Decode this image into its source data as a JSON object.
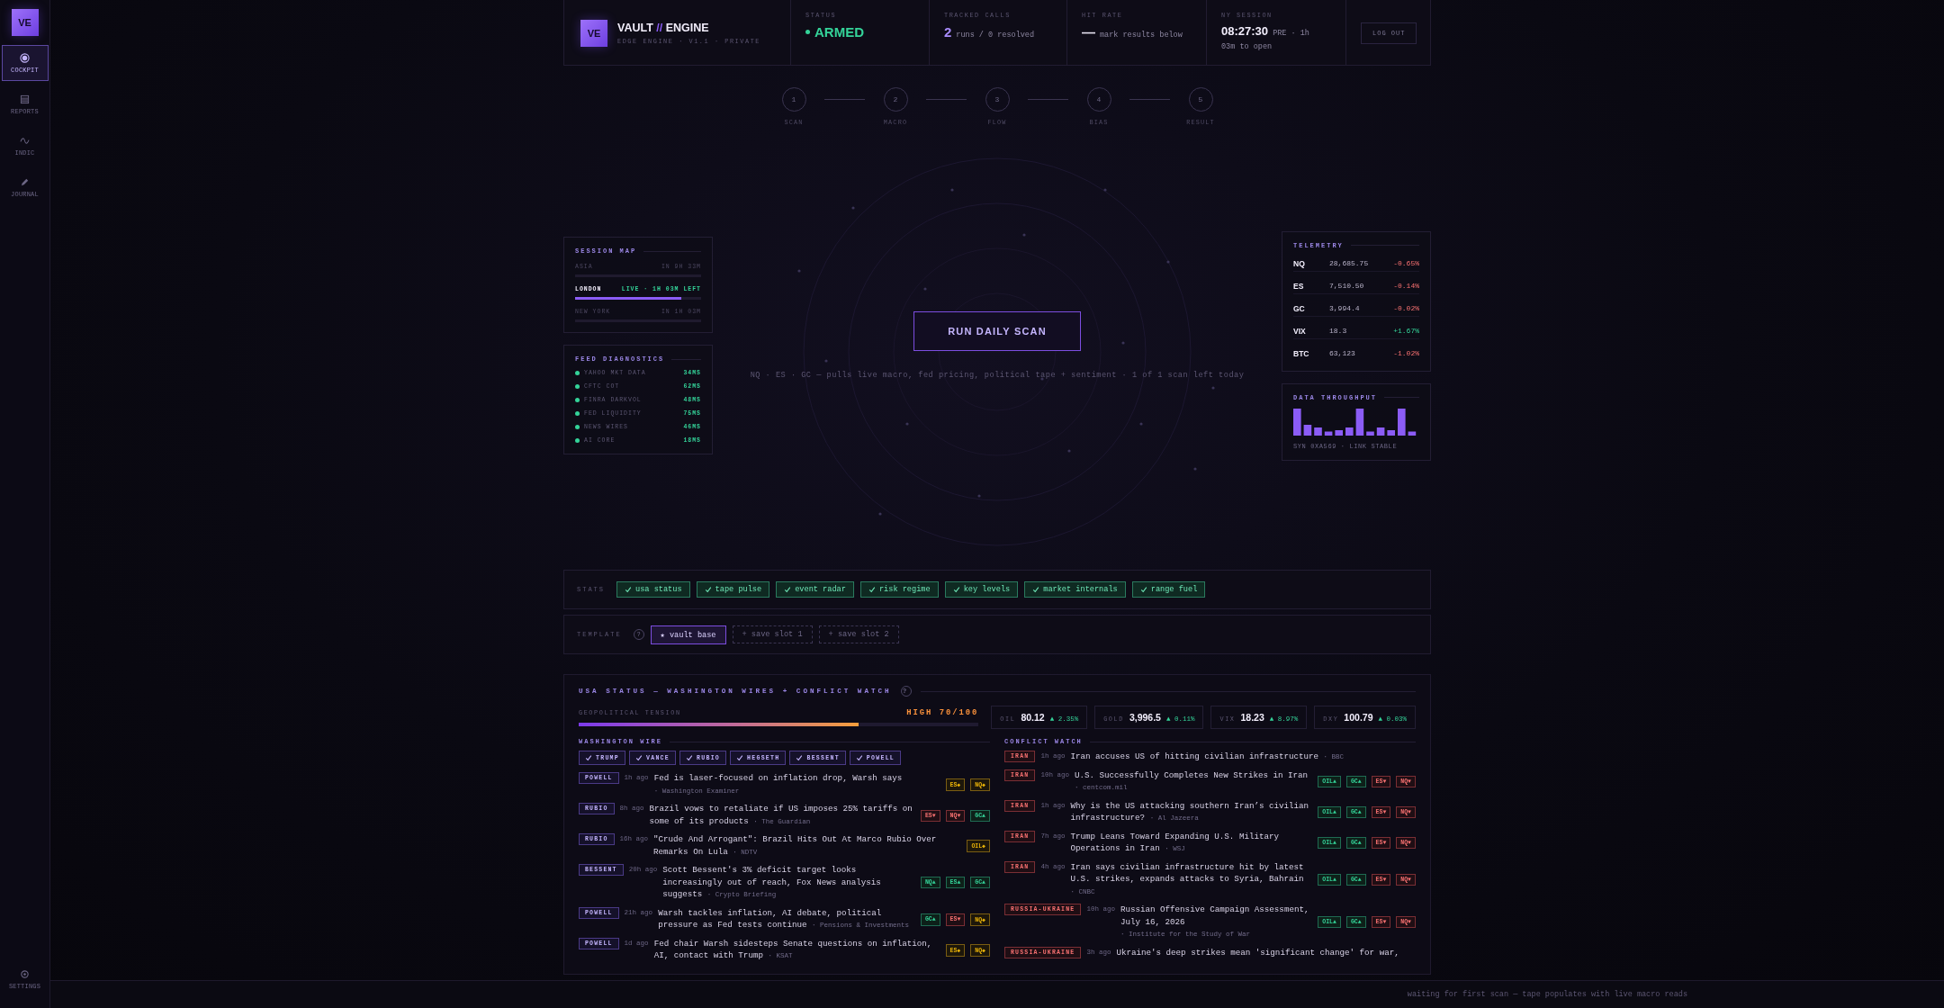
{
  "sidebar": {
    "logo": "VE",
    "items": [
      {
        "label": "COCKPIT",
        "selected": true
      },
      {
        "label": "REPORTS",
        "selected": false
      },
      {
        "label": "INDIC",
        "selected": false
      },
      {
        "label": "JOURNAL",
        "selected": false
      }
    ],
    "settings": "SETTINGS"
  },
  "header": {
    "logo": "VE",
    "title_left": "VAULT",
    "title_separator": "//",
    "title_right": "ENGINE",
    "subtitle": "EDGE ENGINE · V1.1 · PRIVATE",
    "status": {
      "label": "STATUS",
      "value": "ARMED",
      "armed": true
    },
    "tracked": {
      "label": "TRACKED CALLS",
      "count": "2",
      "detail": "runs / 0 resolved"
    },
    "hit_rate": {
      "label": "HIT RATE",
      "value": "—",
      "detail": "mark results below"
    },
    "session": {
      "label": "NY SESSION",
      "time": "08:27:30",
      "detail": "PRE · 1h 03m to open"
    },
    "logout": "LOG OUT"
  },
  "steps": [
    {
      "number": "1",
      "label": "SCAN"
    },
    {
      "number": "2",
      "label": "MACRO"
    },
    {
      "number": "3",
      "label": "FLOW"
    },
    {
      "number": "4",
      "label": "BIAS"
    },
    {
      "number": "5",
      "label": "RESULT"
    }
  ],
  "session_map": {
    "title": "SESSION MAP",
    "rows": [
      {
        "name": "ASIA",
        "status": "IN 9H 33M",
        "live": false
      },
      {
        "name": "LONDON",
        "status": "LIVE · 1H 03M LEFT",
        "live": true,
        "level": 0.84
      },
      {
        "name": "NEW YORK",
        "status": "IN 1H 03M",
        "live": false
      }
    ]
  },
  "feed_diagnostics": {
    "title": "FEED DIAGNOSTICS",
    "feeds": [
      {
        "name": "YAHOO MKT DATA",
        "latency": "34MS"
      },
      {
        "name": "CFTC COT",
        "latency": "62MS"
      },
      {
        "name": "FINRA DARKVOL",
        "latency": "48MS"
      },
      {
        "name": "FED LIQUIDITY",
        "latency": "75MS"
      },
      {
        "name": "NEWS WIRES",
        "latency": "46MS"
      },
      {
        "name": "AI CORE",
        "latency": "18MS"
      }
    ]
  },
  "scan": {
    "button": "RUN DAILY SCAN",
    "note": "NQ · ES · GC — pulls live macro, fed pricing, political tape + sentiment · 1 of 1 scan left today"
  },
  "telemetry": {
    "title": "TELEMETRY",
    "rows": [
      {
        "symbol": "NQ",
        "price": "28,685.75",
        "change": "-0.65%",
        "kind": "down"
      },
      {
        "symbol": "ES",
        "price": "7,510.50",
        "change": "-0.14%",
        "kind": "down"
      },
      {
        "symbol": "GC",
        "price": "3,994.4",
        "change": "-0.02%",
        "kind": "down"
      },
      {
        "symbol": "VIX",
        "price": "18.3",
        "change": "+1.67%",
        "kind": "up"
      },
      {
        "symbol": "BTC",
        "price": "63,123",
        "change": "-1.02%",
        "kind": "down"
      }
    ]
  },
  "throughput": {
    "title": "DATA THROUGHPUT",
    "caption": "SYN 0XA569 · LINK STABLE"
  },
  "stats": {
    "label": "STATS",
    "chips": [
      {
        "label": "usa status",
        "checked": true
      },
      {
        "label": "tape pulse",
        "checked": true
      },
      {
        "label": "event radar",
        "checked": true
      },
      {
        "label": "risk regime",
        "checked": true
      },
      {
        "label": "key levels",
        "checked": true
      },
      {
        "label": "market internals",
        "checked": true
      },
      {
        "label": "range fuel",
        "checked": true
      }
    ]
  },
  "template": {
    "label": "TEMPLATE",
    "help": "?",
    "slots": [
      {
        "label": "★ vault base",
        "selected": true
      },
      {
        "label": "+ save slot 1",
        "selected": false
      },
      {
        "label": "+ save slot 2",
        "selected": false
      }
    ]
  },
  "usa_status": {
    "title": "USA STATUS — WASHINGTON WIRES + CONFLICT WATCH",
    "help": "?",
    "tension": {
      "label": "GEOPOLITICAL TENSION",
      "reading": "HIGH 70/100",
      "level": 0.7
    },
    "quotes": [
      {
        "symbol": "OIL",
        "value": "80.12",
        "change": "▲ 2.35%",
        "kind": "up"
      },
      {
        "symbol": "GOLD",
        "value": "3,996.5",
        "change": "▲ 0.11%",
        "kind": "up"
      },
      {
        "symbol": "VIX",
        "value": "18.23",
        "change": "▲ 8.97%",
        "kind": "up"
      },
      {
        "symbol": "DXY",
        "value": "100.79",
        "change": "▲ 0.03%",
        "kind": "up"
      }
    ],
    "washington": {
      "title": "WASHINGTON WIRE",
      "filters": [
        {
          "label": "TRUMP",
          "checked": true
        },
        {
          "label": "VANCE",
          "checked": true
        },
        {
          "label": "RUBIO",
          "checked": true
        },
        {
          "label": "HEGSETH",
          "checked": true
        },
        {
          "label": "BESSENT",
          "checked": true
        },
        {
          "label": "POWELL",
          "checked": true
        }
      ],
      "items": [
        {
          "tag": "POWELL",
          "age": "1h ago",
          "headline": "Fed is laser-focused on inflation drop, Warsh says",
          "source": "· Washington Examiner",
          "tickers": [
            {
              "text": "ES◆",
              "kind": "flat"
            },
            {
              "text": "NQ◆",
              "kind": "flat"
            }
          ]
        },
        {
          "tag": "RUBIO",
          "age": "8h ago",
          "headline": "Brazil vows to retaliate if US imposes 25% tariffs on some of its products",
          "source": "· The Guardian",
          "tickers": [
            {
              "text": "ES▼",
              "kind": "down"
            },
            {
              "text": "NQ▼",
              "kind": "down"
            },
            {
              "text": "GC▲",
              "kind": "up"
            }
          ]
        },
        {
          "tag": "RUBIO",
          "age": "16h ago",
          "headline": "\"Crude And Arrogant\": Brazil Hits Out At Marco Rubio Over Remarks On Lula",
          "source": "· NDTV",
          "tickers": [
            {
              "text": "OIL◆",
              "kind": "flat"
            }
          ]
        },
        {
          "tag": "BESSENT",
          "age": "20h ago",
          "headline": "Scott Bessent's 3% deficit target looks increasingly out of reach, Fox News analysis suggests",
          "source": "· Crypto Briefing",
          "tickers": [
            {
              "text": "NQ▲",
              "kind": "up"
            },
            {
              "text": "ES▲",
              "kind": "up"
            },
            {
              "text": "GC▲",
              "kind": "up"
            }
          ]
        },
        {
          "tag": "POWELL",
          "age": "21h ago",
          "headline": "Warsh tackles inflation, AI debate, political pressure as Fed tests continue",
          "source": "· Pensions & Investments",
          "tickers": [
            {
              "text": "GC▲",
              "kind": "up"
            },
            {
              "text": "ES▼",
              "kind": "down"
            },
            {
              "text": "NQ◆",
              "kind": "flat"
            }
          ]
        },
        {
          "tag": "POWELL",
          "age": "1d ago",
          "headline": "Fed chair Warsh sidesteps Senate questions on inflation, AI, contact with Trump",
          "source": "· KSAT",
          "tickers": [
            {
              "text": "ES◆",
              "kind": "flat"
            },
            {
              "text": "NQ◆",
              "kind": "flat"
            }
          ]
        }
      ]
    },
    "conflict": {
      "title": "CONFLICT WATCH",
      "items": [
        {
          "tag": "IRAN",
          "age": "1h ago",
          "headline": "Iran accuses US of hitting civilian infrastructure",
          "source": "· BBC"
        },
        {
          "tag": "IRAN",
          "age": "10h ago",
          "headline": "U.S. Successfully Completes New Strikes in Iran",
          "source": "· centcom.mil",
          "tickers": [
            {
              "text": "OIL▲",
              "kind": "up"
            },
            {
              "text": "GC▲",
              "kind": "up"
            },
            {
              "text": "ES▼",
              "kind": "down"
            },
            {
              "text": "NQ▼",
              "kind": "down"
            }
          ]
        },
        {
          "tag": "IRAN",
          "age": "1h ago",
          "headline": "Why is the US attacking southern Iran’s civilian infrastructure?",
          "source": "· Al Jazeera",
          "tickers": [
            {
              "text": "OIL▲",
              "kind": "up"
            },
            {
              "text": "GC▲",
              "kind": "up"
            },
            {
              "text": "ES▼",
              "kind": "down"
            },
            {
              "text": "NQ▼",
              "kind": "down"
            }
          ]
        },
        {
          "tag": "IRAN",
          "age": "7h ago",
          "headline": "Trump Leans Toward Expanding U.S. Military Operations in Iran",
          "source": "· WSJ",
          "tickers": [
            {
              "text": "OIL▲",
              "kind": "up"
            },
            {
              "text": "GC▲",
              "kind": "up"
            },
            {
              "text": "ES▼",
              "kind": "down"
            },
            {
              "text": "NQ▼",
              "kind": "down"
            }
          ]
        },
        {
          "tag": "IRAN",
          "age": "4h ago",
          "headline": "Iran says civilian infrastructure hit by latest U.S. strikes, expands attacks to Syria, Bahrain",
          "source": "· CNBC",
          "tickers": [
            {
              "text": "OIL▲",
              "kind": "up"
            },
            {
              "text": "GC▲",
              "kind": "up"
            },
            {
              "text": "ES▼",
              "kind": "down"
            },
            {
              "text": "NQ▼",
              "kind": "down"
            }
          ]
        },
        {
          "tag": "RUSSIA-UKRAINE",
          "age": "10h ago",
          "headline": "Russian Offensive Campaign Assessment, July 16, 2026",
          "source": "· Institute for the Study of War",
          "tickers": [
            {
              "text": "OIL▲",
              "kind": "up"
            },
            {
              "text": "GC▲",
              "kind": "up"
            },
            {
              "text": "ES▼",
              "kind": "down"
            },
            {
              "text": "NQ▼",
              "kind": "down"
            }
          ]
        },
        {
          "tag": "RUSSIA-UKRAINE",
          "age": "3h ago",
          "headline": "Ukraine's deep strikes mean 'significant change' for war,"
        }
      ]
    }
  },
  "status_bar": "waiting for first scan — tape populates with live macro reads"
}
